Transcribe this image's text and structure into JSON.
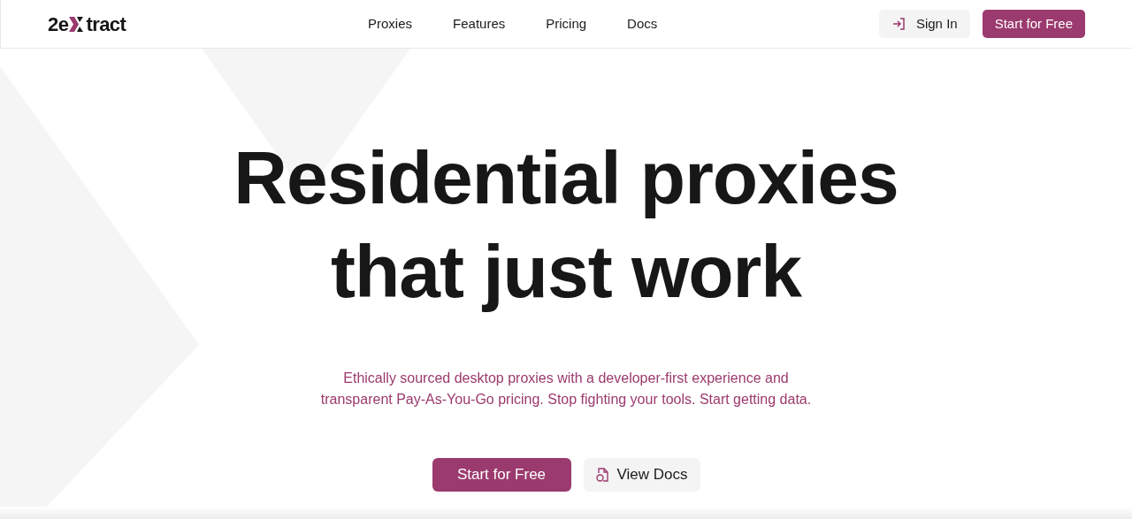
{
  "logo": {
    "prefix": "2e",
    "suffix": "tract"
  },
  "nav": [
    {
      "label": "Proxies"
    },
    {
      "label": "Features"
    },
    {
      "label": "Pricing"
    },
    {
      "label": "Docs"
    }
  ],
  "header_actions": [
    {
      "kind": "secondary",
      "label": "Sign In"
    },
    {
      "kind": "primary",
      "label": "Start for Free"
    }
  ],
  "hero": {
    "title_lines": [
      "Residential proxies",
      "that just work"
    ],
    "subtitle_lines": [
      "Ethically sourced desktop proxies with a developer-first experience and",
      "transparent Pay-As-You-Go pricing. Stop fighting your tools. Start getting data."
    ],
    "buttons": [
      {
        "kind": "primary",
        "label": "Start for Free"
      },
      {
        "kind": "secondary",
        "label": "View Docs"
      }
    ]
  }
}
